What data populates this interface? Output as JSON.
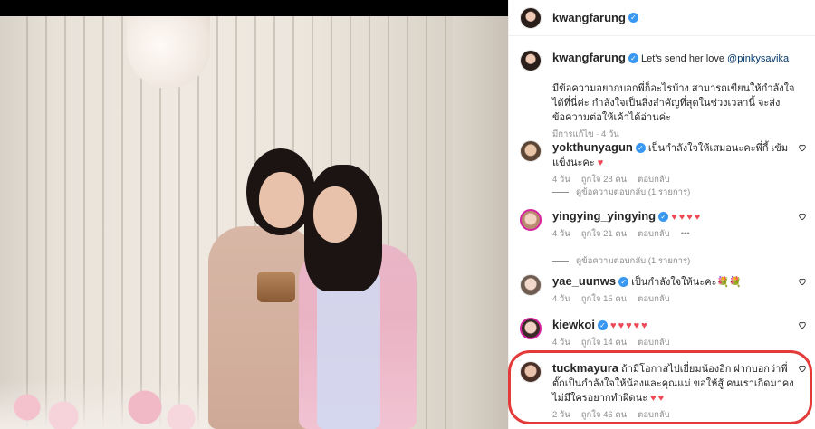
{
  "post": {
    "author": "kwangfarung",
    "caption_mention": "@pinkysavika",
    "caption_lead": "Let's send her love",
    "caption_body": "มีข้อความอยากบอกพี่ก็อะไรบ้าง สามารถเขียนให้กำลังใจได้ที่นี่ค่ะ กำลังใจเป็นสิ่งสำคัญที่สุดในช่วงเวลานี้ จะส่งข้อความต่อให้เค้าได้อ่านค่ะ",
    "caption_meta": "มีการแก้ไข · 4 วัน"
  },
  "ui": {
    "reply_label": "ตอบกลับ",
    "view_replies": "ดูข้อความตอบกลับ (1 รายการ)",
    "more": "•••"
  },
  "comments": [
    {
      "user": "yokthunyagun",
      "verified": true,
      "text": "เป็นกำลังใจให้เสมอนะคะพี่กี้ เข้มแข็งนะคะ",
      "emoji": "♥",
      "age": "4 วัน",
      "likes": "ถูกใจ 28 คน"
    },
    {
      "user": "yingying_yingying",
      "verified": true,
      "text": "",
      "emoji": "♥♥♥♥",
      "age": "4 วัน",
      "likes": "ถูกใจ 21 คน"
    },
    {
      "user": "yae_uunws",
      "verified": true,
      "text": "เป็นกำลังใจให้นะคะ",
      "emoji": "💐💐",
      "age": "4 วัน",
      "likes": "ถูกใจ 15 คน"
    },
    {
      "user": "kiewkoi",
      "verified": true,
      "text": "",
      "emoji": "♥♥♥♥♥",
      "age": "4 วัน",
      "likes": "ถูกใจ 14 คน"
    },
    {
      "user": "tuckmayura",
      "verified": false,
      "text": "ถ้ามีโอกาสไปเยี่ยมน้องอีก ฝากบอกว่าพี่ตั๊กเป็นกำลังใจให้น้องและคุณแม่ ขอให้สู้ คนเราเกิดมาคงไม่มีใครอยากทำผิดนะ",
      "emoji": "♥♥",
      "age": "2 วัน",
      "likes": "ถูกใจ 46 คน"
    }
  ],
  "icons": {
    "verified": "verified-badge-icon",
    "like": "heart-outline-icon"
  },
  "colors": {
    "highlight": "#e53a3a",
    "heart": "#ed4956",
    "verified": "#3897f0",
    "mention": "#00376b"
  }
}
